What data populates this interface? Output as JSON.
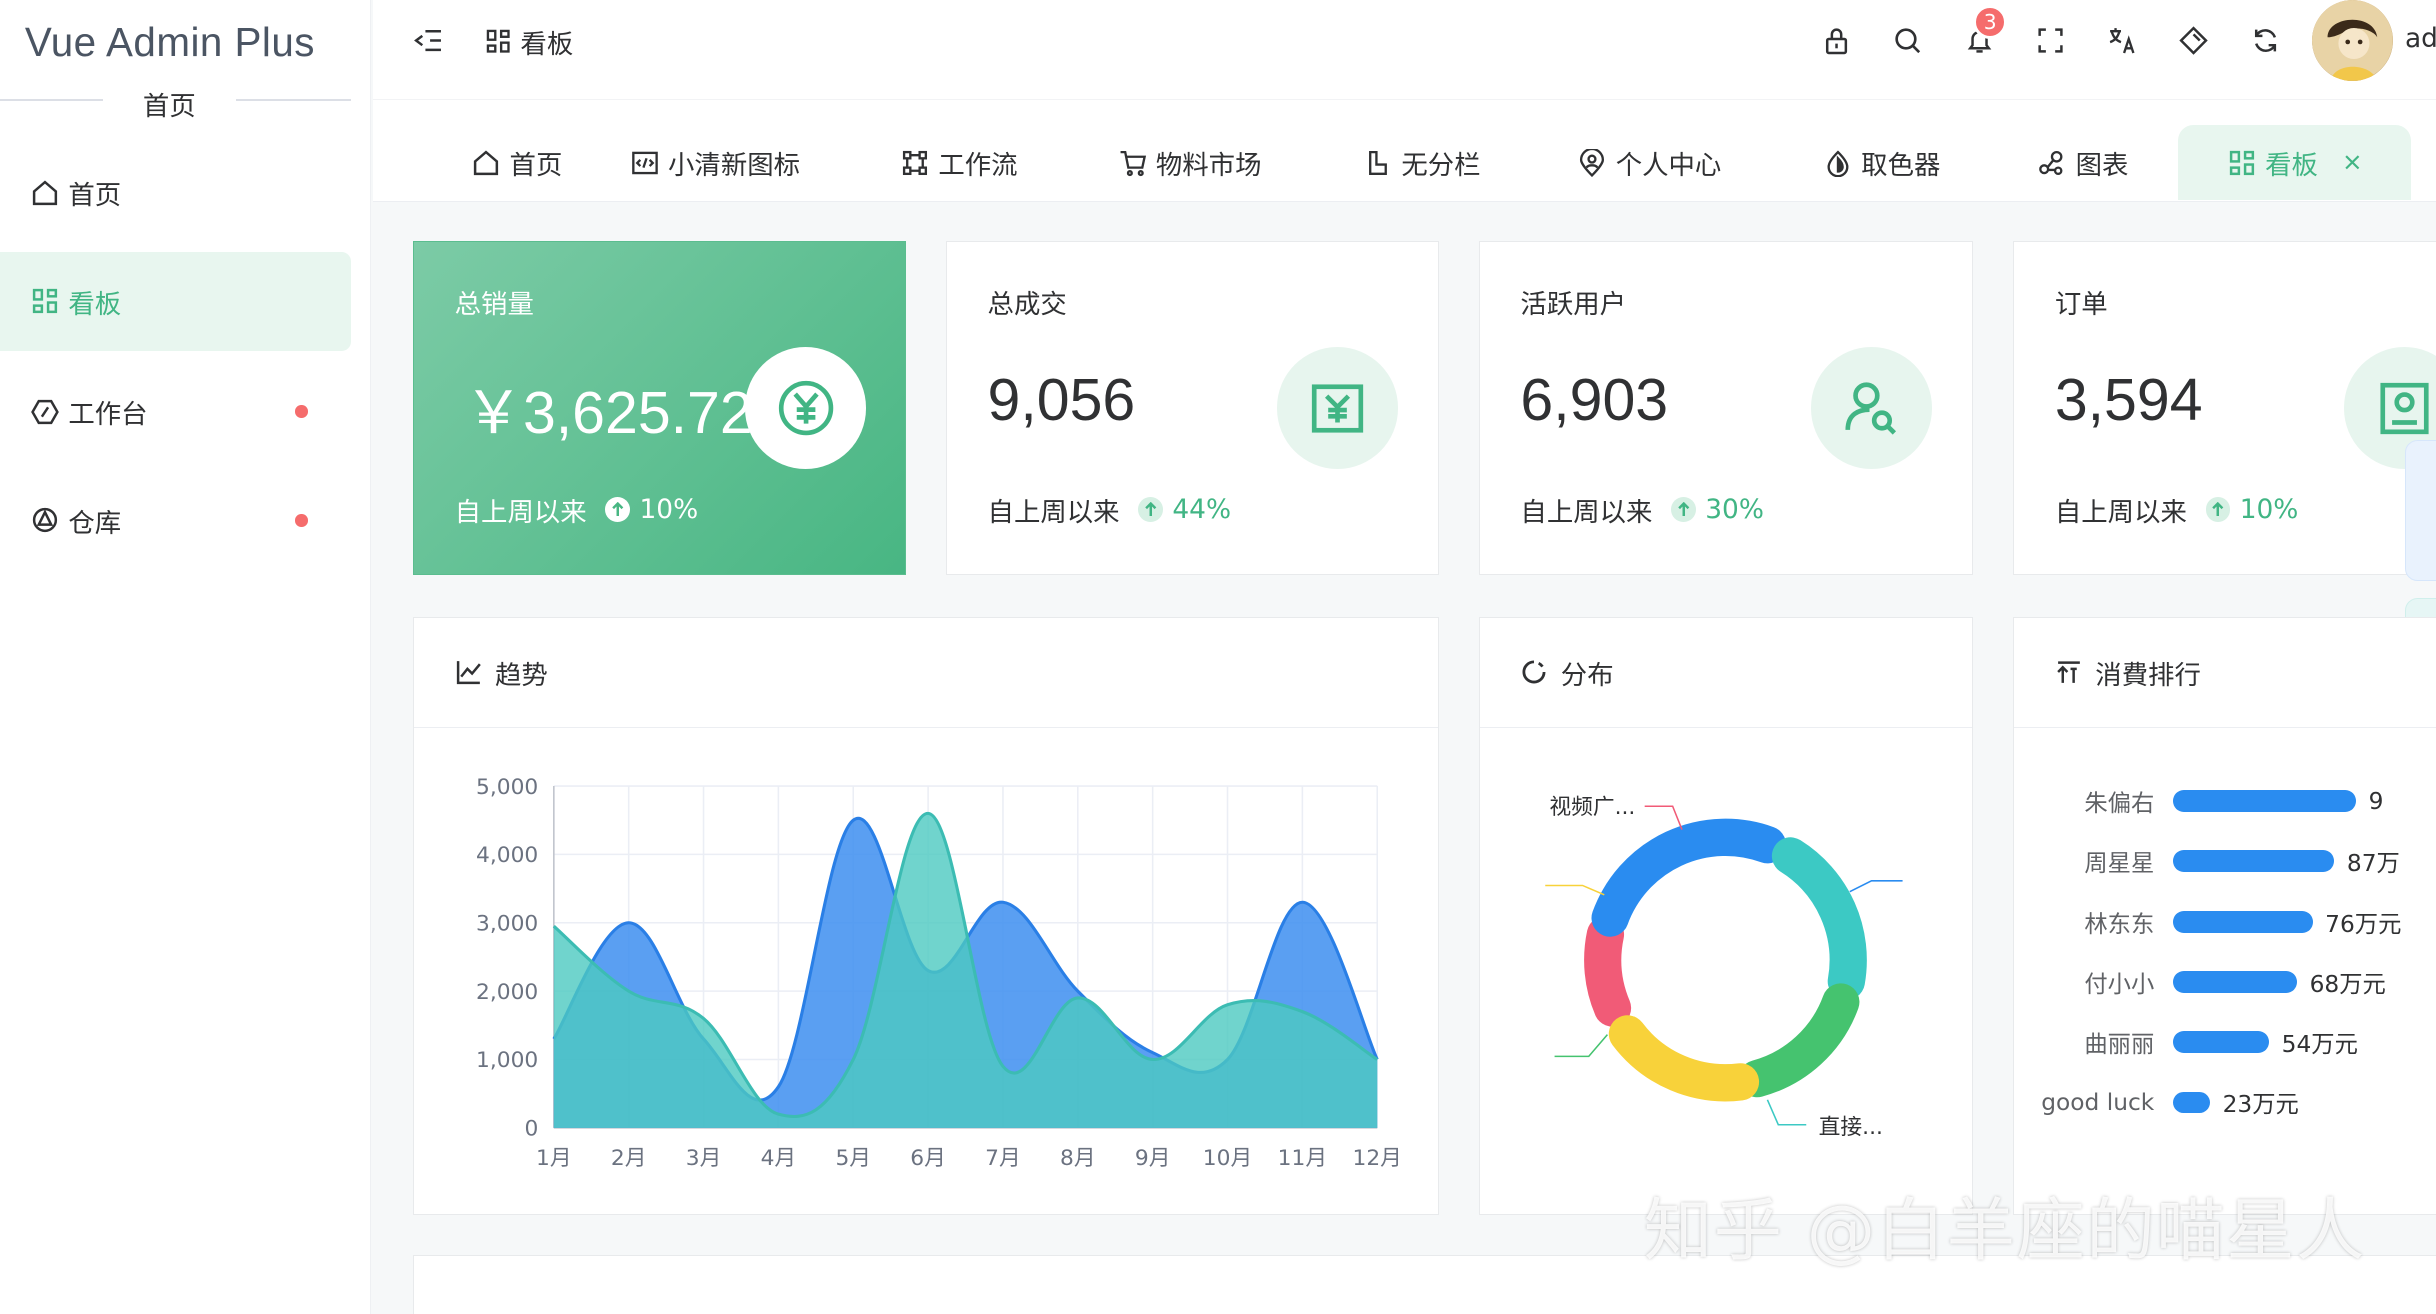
{
  "app": {
    "title": "Vue Admin Plus",
    "subtitle": "首页"
  },
  "sidebar": {
    "items": [
      {
        "label": "首页",
        "icon": "home-icon"
      },
      {
        "label": "看板",
        "icon": "dashboard-icon",
        "active": true
      },
      {
        "label": "工作台",
        "icon": "workbench-icon",
        "dot": true
      },
      {
        "label": "仓库",
        "icon": "warehouse-icon",
        "dot": true
      }
    ]
  },
  "header": {
    "breadcrumb": "看板",
    "notification_count": "3",
    "username": "ad"
  },
  "tabs": [
    {
      "label": "首页",
      "icon": "home-icon"
    },
    {
      "label": "小清新图标",
      "icon": "code-icon"
    },
    {
      "label": "工作流",
      "icon": "workflow-icon"
    },
    {
      "label": "物料市场",
      "icon": "cart-icon"
    },
    {
      "label": "无分栏",
      "icon": "layout-icon"
    },
    {
      "label": "个人中心",
      "icon": "user-location-icon"
    },
    {
      "label": "取色器",
      "icon": "color-drop-icon"
    },
    {
      "label": "图表",
      "icon": "chart-nodes-icon"
    },
    {
      "label": "看板",
      "icon": "dashboard-icon",
      "active": true
    }
  ],
  "stats": [
    {
      "title": "总销量",
      "value": "￥3,625.72",
      "foot": "自上周以来",
      "change": "10%",
      "icon": "yen-circle-icon"
    },
    {
      "title": "总成交",
      "value": "9,056",
      "foot": "自上周以来",
      "change": "44%",
      "icon": "yen-box-icon"
    },
    {
      "title": "活跃用户",
      "value": "6,903",
      "foot": "自上周以来",
      "change": "30%",
      "icon": "user-search-icon"
    },
    {
      "title": "订单",
      "value": "3,594",
      "foot": "自上周以来",
      "change": "10%",
      "icon": "order-icon"
    }
  ],
  "panels": {
    "trend": "趋势",
    "distribution": "分布",
    "ranking": "消費排行"
  },
  "chart_data": [
    {
      "type": "area",
      "categories": [
        "1月",
        "2月",
        "3月",
        "4月",
        "5月",
        "6月",
        "7月",
        "8月",
        "9月",
        "10月",
        "11月",
        "12月"
      ],
      "yticks": [
        "0",
        "1,000",
        "2,000",
        "3,000",
        "4,000",
        "5,000"
      ],
      "ylim": [
        0,
        5000
      ],
      "grid": true,
      "series": [
        {
          "color": "#3d8ef0",
          "values": [
            1300,
            3000,
            1300,
            600,
            4500,
            2300,
            3300,
            2000,
            1100,
            1000,
            3300,
            1000
          ]
        },
        {
          "color": "#4cc9c0",
          "values": [
            2950,
            2000,
            1600,
            200,
            1000,
            4600,
            900,
            1900,
            1000,
            1800,
            1700,
            1000
          ]
        }
      ]
    },
    {
      "type": "pie",
      "slices": [
        {
          "label": "视频广...",
          "color": "#f15b77"
        },
        {
          "label": "",
          "color": "#2a8cf0"
        },
        {
          "label": "直接...",
          "color": "#3cc9c4"
        },
        {
          "label": "",
          "color": "#45c36f"
        },
        {
          "label": "",
          "color": "#f8d23a"
        }
      ]
    },
    {
      "type": "bar",
      "categories": [
        "朱偏右",
        "周星星",
        "林东东",
        "付小小",
        "曲丽丽",
        "good luck"
      ],
      "value_labels": [
        "9",
        "87万",
        "76万元",
        "68万元",
        "54万元",
        "23万元"
      ]
    }
  ],
  "watermark": "知乎 @白羊座的喵星人",
  "colors": {
    "accent": "#41b584",
    "danger": "#f56c6c",
    "bar": "#2a8cf0"
  }
}
